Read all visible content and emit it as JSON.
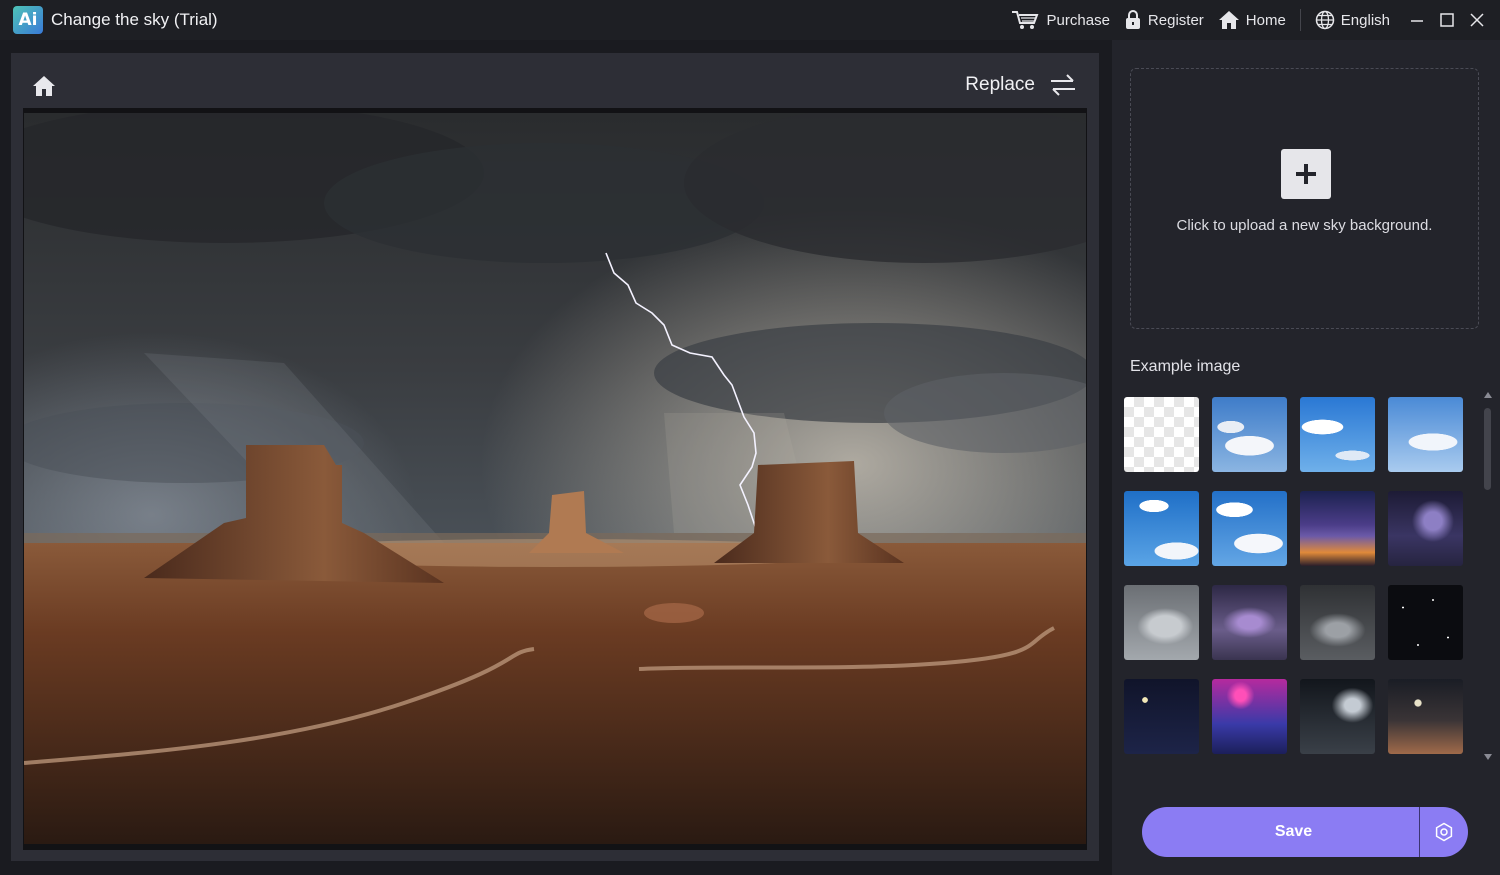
{
  "app": {
    "logo_text": "Ai",
    "title": "Change the sky (Trial)"
  },
  "topbar": {
    "purchase": "Purchase",
    "register": "Register",
    "home": "Home",
    "language": "English"
  },
  "editor": {
    "replace_label": "Replace"
  },
  "sidebar": {
    "upload_text": "Click to upload a new sky background.",
    "example_label": "Example image",
    "thumbnails": [
      {
        "name": "transparent"
      },
      {
        "name": "blue-sky-clouds-1"
      },
      {
        "name": "blue-sky-clouds-2"
      },
      {
        "name": "blue-sky-clouds-3"
      },
      {
        "name": "blue-sky-clouds-4"
      },
      {
        "name": "blue-sky-clouds-5"
      },
      {
        "name": "purple-storm-sunset"
      },
      {
        "name": "purple-lightning"
      },
      {
        "name": "grey-clouds"
      },
      {
        "name": "purple-clouds"
      },
      {
        "name": "dark-storm-clouds"
      },
      {
        "name": "starry-night"
      },
      {
        "name": "crescent-moon-night"
      },
      {
        "name": "magenta-moon"
      },
      {
        "name": "moonlit-clouds"
      },
      {
        "name": "dusk-moon"
      }
    ],
    "save_label": "Save"
  },
  "colors": {
    "accent": "#8b7cf3",
    "background": "#1a1b20",
    "panel": "#2d2e36",
    "sidebar": "#23242b"
  }
}
